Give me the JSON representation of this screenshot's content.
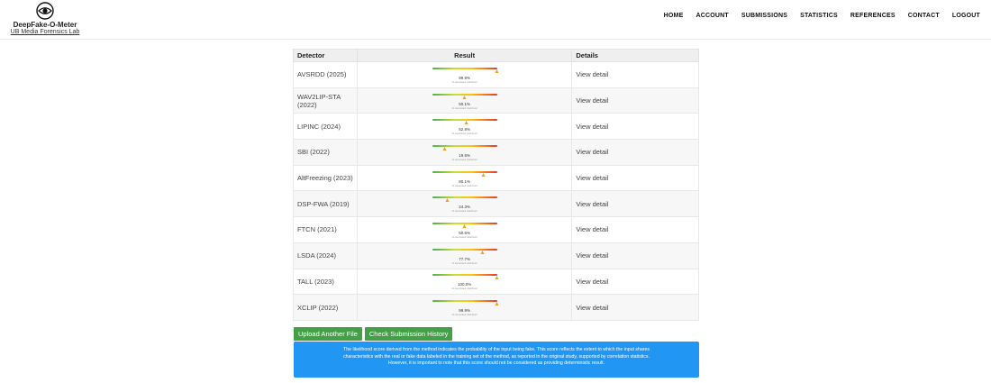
{
  "brand": {
    "name": "DeepFake-O-Meter",
    "lab": "UB Media Forensics Lab"
  },
  "nav": [
    "HOME",
    "ACCOUNT",
    "SUBMISSIONS",
    "STATISTICS",
    "REFERENCES",
    "CONTACT",
    "LOGOUT"
  ],
  "table": {
    "headers": {
      "detector": "Detector",
      "result": "Result",
      "details": "Details"
    },
    "caption": "AI-Generated Likelihood",
    "rows": [
      {
        "detector": "AVSRDD (2025)",
        "pct": "99.9%",
        "score": 99.9,
        "detail": "View detail"
      },
      {
        "detector": "WAV2LIP-STA (2022)",
        "pct": "50.1%",
        "score": 50.1,
        "detail": "View detail"
      },
      {
        "detector": "LIPINC (2024)",
        "pct": "52.8%",
        "score": 52.8,
        "detail": "View detail"
      },
      {
        "detector": "SBI (2022)",
        "pct": "19.5%",
        "score": 19.5,
        "detail": "View detail"
      },
      {
        "detector": "AltFreezing (2023)",
        "pct": "80.1%",
        "score": 80.1,
        "detail": "View detail"
      },
      {
        "detector": "DSP-FWA (2019)",
        "pct": "24.3%",
        "score": 24.3,
        "detail": "View detail"
      },
      {
        "detector": "FTCN (2021)",
        "pct": "50.6%",
        "score": 50.6,
        "detail": "View detail"
      },
      {
        "detector": "LSDA (2024)",
        "pct": "77.7%",
        "score": 77.7,
        "detail": "View detail"
      },
      {
        "detector": "TALL (2023)",
        "pct": "100.0%",
        "score": 100.0,
        "detail": "View detail"
      },
      {
        "detector": "XCLIP (2022)",
        "pct": "99.9%",
        "score": 99.9,
        "detail": "View detail"
      }
    ]
  },
  "buttons": {
    "upload": "Upload Another File",
    "history": "Check Submission History"
  },
  "notice": {
    "line1": "The likelihood score derived from the method indicates the probability of the input being fake. This score reflects the extent to which the input shares",
    "line2": "characteristics with the real or fake data labeled in the training set of the method, as reported in the original study, supported by correlation statistics.",
    "line3": "However, it is important to note that this score should not be considered as providing deterministic result."
  },
  "colors": {
    "button_green": "#43a047",
    "notice_blue": "#2196f3",
    "marker_orange": "#f0a020"
  }
}
